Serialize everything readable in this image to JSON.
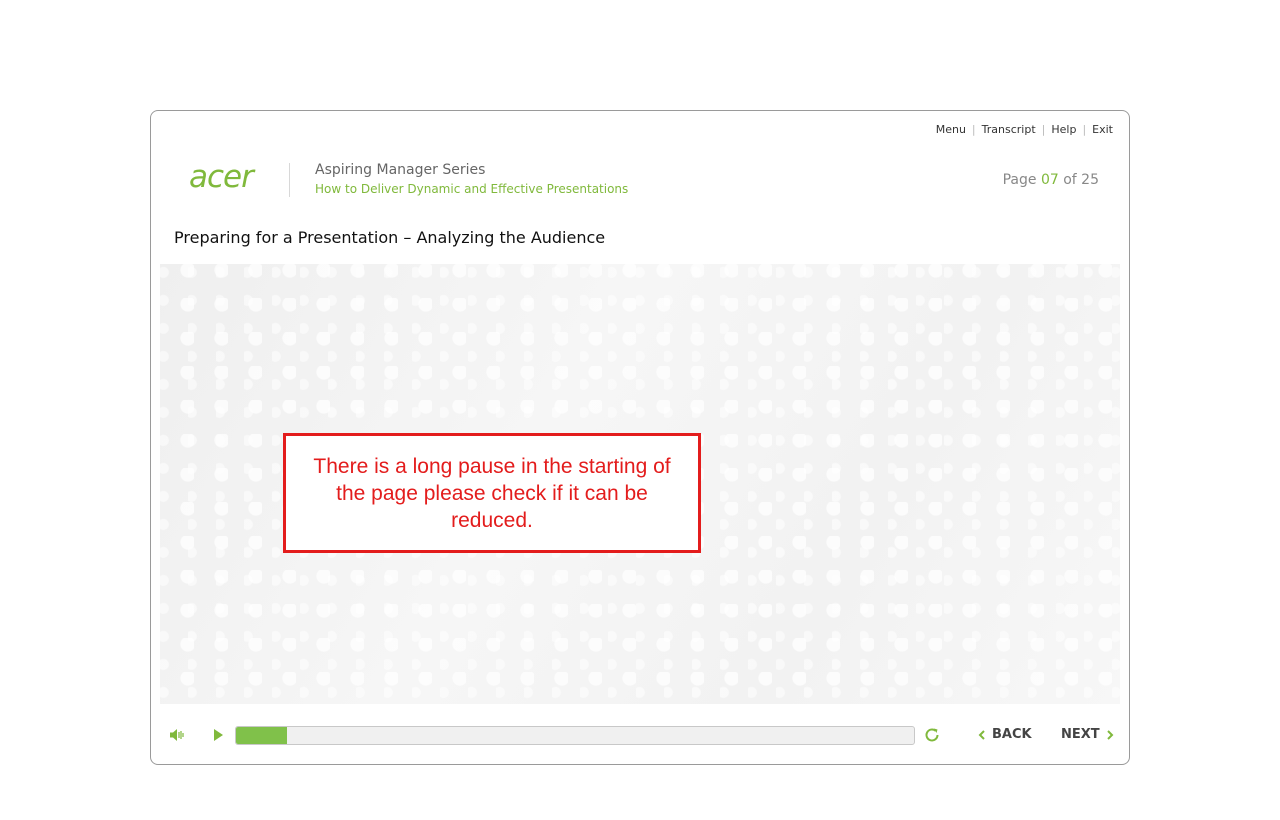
{
  "top_nav": {
    "menu": "Menu",
    "transcript": "Transcript",
    "help": "Help",
    "exit": "Exit",
    "separator": "|"
  },
  "brand": {
    "logo_text": "acer",
    "series": "Aspiring Manager Series",
    "course": "How to Deliver Dynamic and Effective Presentations"
  },
  "page_counter": {
    "prefix": "Page",
    "current": "07",
    "of_label": "of",
    "total": "25"
  },
  "heading": "Preparing for a Presentation – Analyzing the Audience",
  "review_note": "There is a long pause in the starting of the page please check if it can be reduced.",
  "player": {
    "volume_icon": "volume-icon",
    "play_icon": "play-icon",
    "replay_icon": "replay-icon",
    "progress": 0.075
  },
  "navigation": {
    "back": "BACK",
    "next": "NEXT"
  },
  "colors": {
    "brand_green": "#80b93c",
    "progress_green": "#80c14a",
    "note_red": "#e31c1c"
  }
}
